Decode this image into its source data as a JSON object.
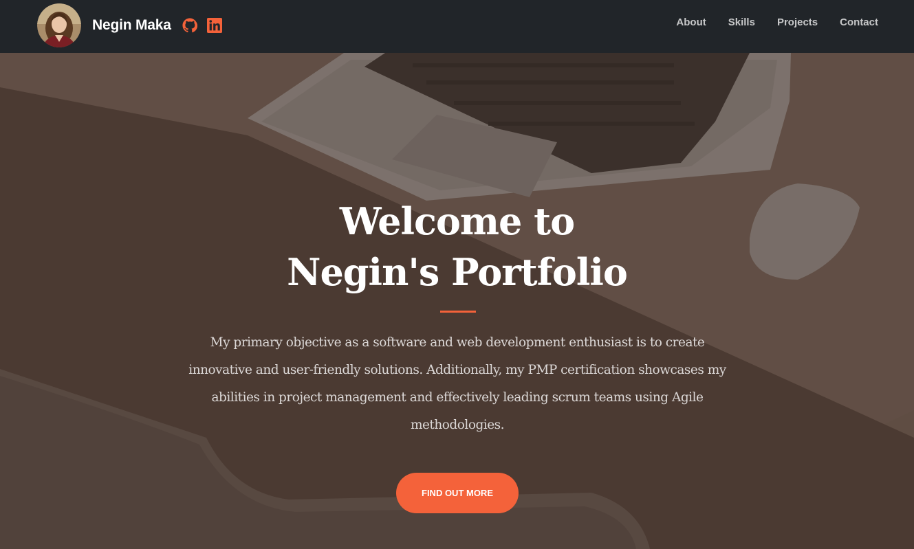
{
  "navbar": {
    "brand_name": "Negin Maka",
    "links": [
      {
        "label": "About"
      },
      {
        "label": "Skills"
      },
      {
        "label": "Projects"
      },
      {
        "label": "Contact"
      }
    ],
    "social_icons": [
      "github-icon",
      "linkedin-icon"
    ],
    "background_color": "#212529"
  },
  "hero": {
    "title_line1": "Welcome to",
    "title_line2": "Negin's Portfolio",
    "description": "My primary objective as a software and web development enthusiast is to create innovative and user-friendly solutions. Additionally, my PMP certification showcases my abilities in project management and effectively leading scrum teams using Agile methodologies.",
    "cta_label": "FIND OUT MORE"
  },
  "colors": {
    "accent": "#f4623a"
  }
}
